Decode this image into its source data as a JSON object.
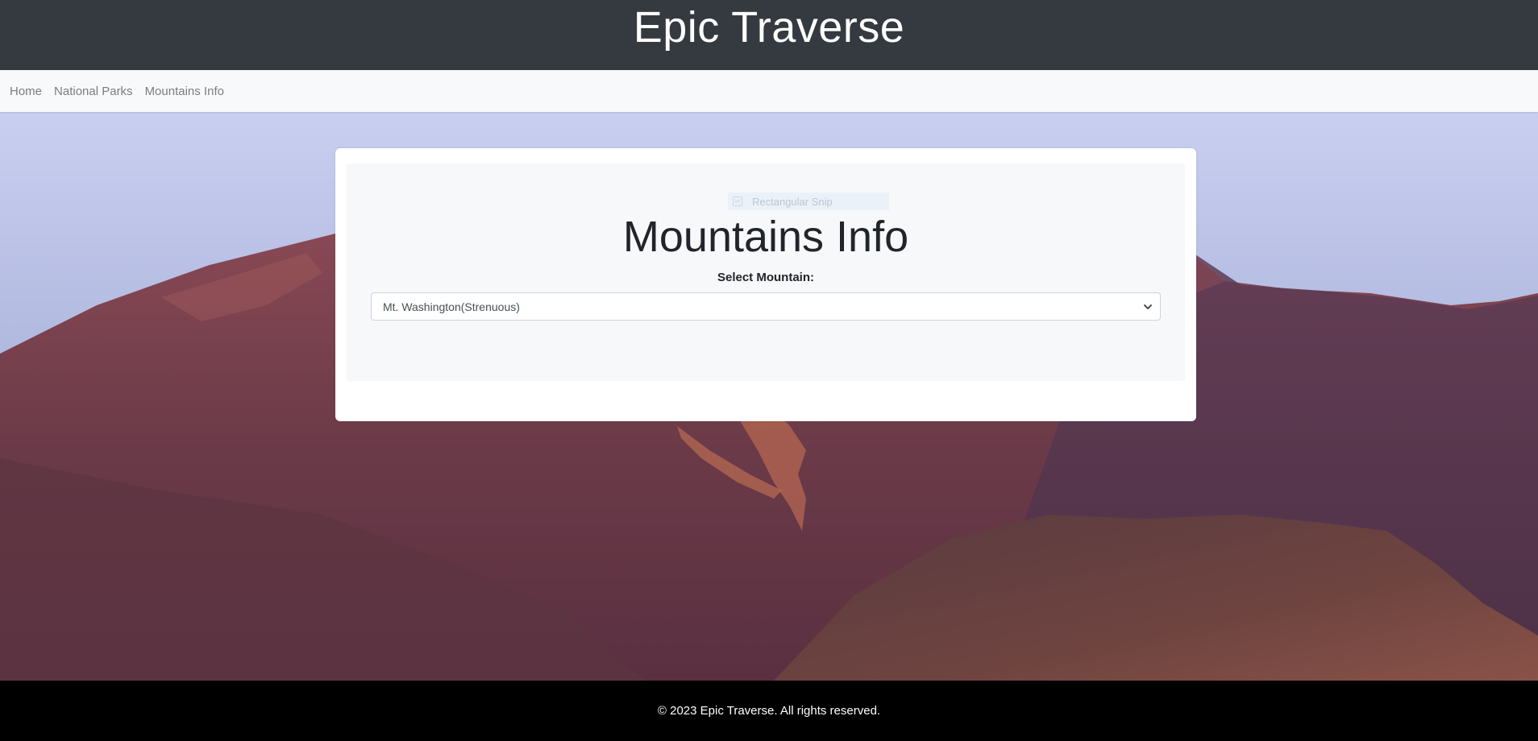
{
  "header": {
    "title": "Epic Traverse"
  },
  "nav": {
    "items": [
      {
        "label": "Home"
      },
      {
        "label": "National Parks"
      },
      {
        "label": "Mountains Info"
      }
    ]
  },
  "main": {
    "heading": "Mountains Info",
    "select_label": "Select Mountain:",
    "selected_mountain": "Mt. Washington(Strenuous)"
  },
  "overlay": {
    "snip_label": "Rectangular Snip",
    "snip_icon": "scissors-icon"
  },
  "footer": {
    "copyright": "© 2023 Epic Traverse. All rights reserved."
  },
  "colors": {
    "header_bg": "#343a40",
    "nav_bg": "#f8f9fa",
    "footer_bg": "#000000",
    "mountain_main": "#6b3a48",
    "sky": "#c9cff0"
  },
  "background_image": "mountain-landscape-photo"
}
